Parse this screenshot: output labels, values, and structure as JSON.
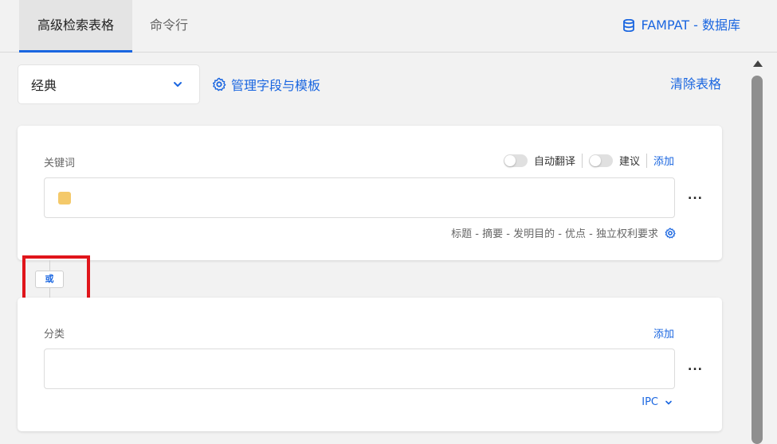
{
  "tabs": {
    "advanced_label": "高级检索表格",
    "cmd_label": "命令行"
  },
  "database": {
    "label": "FAMPAT - 数据库"
  },
  "toolbar": {
    "mode_value": "经典",
    "manage_label": "管理字段与模板",
    "clear_label": "清除表格"
  },
  "keyword": {
    "label": "关键词",
    "auto_translate": "自动翻译",
    "suggest": "建议",
    "add": "添加",
    "fields_hint": "标题 - 摘要 - 发明目的 - 优点 - 独立权利要求",
    "more": "..."
  },
  "operator": {
    "label": "或"
  },
  "classification": {
    "label": "分类",
    "add": "添加",
    "scheme": "IPC",
    "more": "..."
  },
  "colors": {
    "accent": "#1a66e0",
    "highlight": "#e0151b",
    "chip": "#f4c96a"
  }
}
